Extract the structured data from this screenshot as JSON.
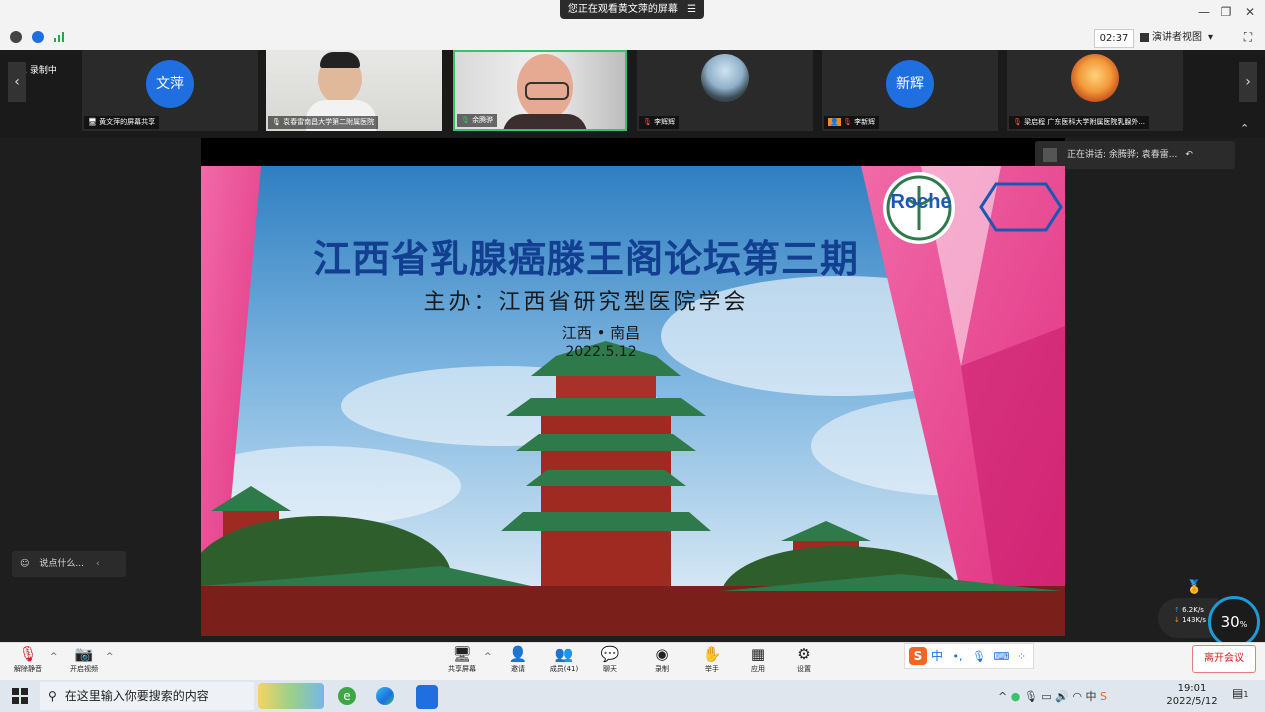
{
  "window": {
    "watch_banner": "您正在观看黄文萍的屏幕",
    "minimize": "—",
    "restore": "❐",
    "close": "✕"
  },
  "toolbar": {
    "timer": "02:37",
    "view_mode": "演讲者视图"
  },
  "recording": {
    "label": "录制中"
  },
  "participants": [
    {
      "label": "黄文萍的屏幕共享",
      "avatar_text": "文萍",
      "type": "avatar"
    },
    {
      "label": "袁春雷南昌大学第二附属医院",
      "type": "camera"
    },
    {
      "label": "余腾骅",
      "type": "camera-active"
    },
    {
      "label": "李辉辉",
      "type": "photo"
    },
    {
      "label": "李新辉",
      "avatar_text": "新辉",
      "type": "avatar"
    },
    {
      "label": "梁启程  广东医科大学附属医院乳腺外...",
      "type": "photo"
    }
  ],
  "speaking": {
    "text": "正在讲话: 余腾骅; 袁春雷..."
  },
  "chat": {
    "placeholder": "说点什么..."
  },
  "slide": {
    "title": "江西省乳腺癌滕王阁论坛第三期",
    "subtitle": "主办：江西省研究型医院学会",
    "location": "江西 • 南昌",
    "date": "2022.5.12",
    "logo_text": "Roche"
  },
  "network": {
    "up": "6.2K/s",
    "down": "143K/s",
    "gauge": "30",
    "gauge_unit": "%"
  },
  "controls": {
    "mute": "解除静音",
    "video": "开启视频",
    "share": "共享屏幕",
    "invite": "邀请",
    "members": "成员(41)",
    "chat": "聊天",
    "record": "录制",
    "raise_hand": "举手",
    "apps": "应用",
    "settings": "设置",
    "leave": "离开会议"
  },
  "ime": {
    "mode": "中"
  },
  "taskbar": {
    "search_placeholder": "在这里输入你要搜索的内容",
    "time": "19:01",
    "date": "2022/5/12",
    "notification_count": "1"
  }
}
